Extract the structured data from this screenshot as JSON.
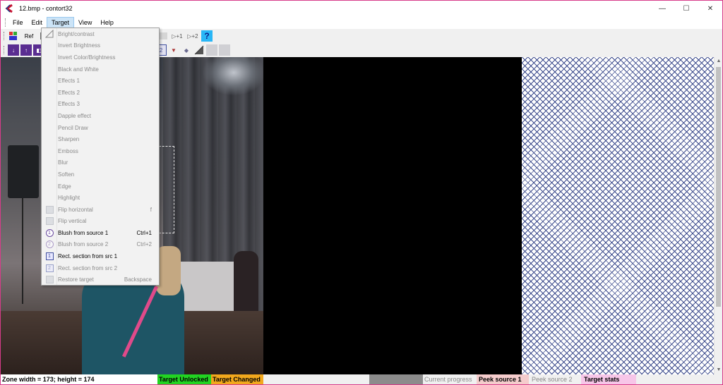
{
  "window": {
    "title": "12.bmp - contort32",
    "controls": {
      "minimize": "—",
      "maximize": "☐",
      "close": "✕"
    }
  },
  "menubar": {
    "items": [
      "File",
      "Edit",
      "Target",
      "View",
      "Help"
    ],
    "active": "Target"
  },
  "toolbar1": {
    "buttons": [
      {
        "icon": "rgb-icon",
        "label": ""
      },
      {
        "icon": "ref-icon",
        "label": "Ref"
      },
      {
        "icon": "frame-icon",
        "label": ""
      },
      {
        "icon": "blank-icon",
        "label": ""
      },
      {
        "icon": "step1-icon",
        "label": "▷+1"
      },
      {
        "icon": "step2-icon",
        "label": "▷+2"
      },
      {
        "icon": "help-icon",
        "label": "?"
      }
    ]
  },
  "toolbar2": {
    "buttons": [
      {
        "icon": "down-arrow-icon",
        "label": ""
      },
      {
        "icon": "up-arrow-icon",
        "label": ""
      },
      {
        "icon": "select-icon",
        "label": ""
      },
      {
        "icon": "src2-icon",
        "label": "2"
      },
      {
        "icon": "paint-icon",
        "label": ""
      },
      {
        "icon": "eraser-icon",
        "label": ""
      },
      {
        "icon": "brightness-icon",
        "label": ""
      },
      {
        "icon": "flip-h-icon",
        "label": ""
      },
      {
        "icon": "flip-v-icon",
        "label": ""
      }
    ]
  },
  "dropdown": {
    "items": [
      {
        "label": "Bright/contrast",
        "shortcut": "",
        "enabled": false,
        "icon": "brightness-icon"
      },
      {
        "label": "Invert Brightness",
        "shortcut": "",
        "enabled": false,
        "icon": ""
      },
      {
        "label": "Invert Color/Brightness",
        "shortcut": "",
        "enabled": false,
        "icon": ""
      },
      {
        "label": "Black and White",
        "shortcut": "",
        "enabled": false,
        "icon": ""
      },
      {
        "label": "Effects 1",
        "shortcut": "",
        "enabled": false,
        "icon": ""
      },
      {
        "label": "Effects 2",
        "shortcut": "",
        "enabled": false,
        "icon": ""
      },
      {
        "label": "Effects 3",
        "shortcut": "",
        "enabled": false,
        "icon": ""
      },
      {
        "label": "Dapple effect",
        "shortcut": "",
        "enabled": false,
        "icon": ""
      },
      {
        "label": "Pencil Draw",
        "shortcut": "",
        "enabled": false,
        "icon": ""
      },
      {
        "label": "Sharpen",
        "shortcut": "",
        "enabled": false,
        "icon": ""
      },
      {
        "label": "Emboss",
        "shortcut": "",
        "enabled": false,
        "icon": ""
      },
      {
        "label": "Blur",
        "shortcut": "",
        "enabled": false,
        "icon": ""
      },
      {
        "label": "Soften",
        "shortcut": "",
        "enabled": false,
        "icon": ""
      },
      {
        "label": "Edge",
        "shortcut": "",
        "enabled": false,
        "icon": ""
      },
      {
        "label": "Highlight",
        "shortcut": "",
        "enabled": false,
        "icon": ""
      },
      {
        "label": "Flip horizontal",
        "shortcut": "f",
        "enabled": false,
        "icon": "flip-horizontal-icon"
      },
      {
        "label": "Flip vertical",
        "shortcut": "",
        "enabled": false,
        "icon": "flip-vertical-icon"
      },
      {
        "label": "Blush from source 1",
        "shortcut": "Ctrl+1",
        "enabled": true,
        "icon": "source1-circle-icon"
      },
      {
        "label": "Blush from source 2",
        "shortcut": "Ctrl+2",
        "enabled": false,
        "icon": "source2-circle-icon"
      },
      {
        "label": "Rect. section from src 1",
        "shortcut": "",
        "enabled": true,
        "icon": "source1-rect-icon"
      },
      {
        "label": "Rect. section from src 2",
        "shortcut": "",
        "enabled": false,
        "icon": "source2-rect-icon"
      },
      {
        "label": "Restore target",
        "shortcut": "Backspace",
        "enabled": false,
        "icon": "restore-icon"
      }
    ]
  },
  "statusbar": {
    "zone": "Zone width = 173; height = 174",
    "unlocked": "Target Unlocked",
    "changed": "Target Changed",
    "current_progress": "Current progress",
    "peek1": "Peek source 1",
    "peek2": "Peek source 2",
    "target_stats": "Target stats"
  },
  "colors": {
    "unlocked": "#22d422",
    "changed": "#f2a81d",
    "peek1": "#f5cccc",
    "target_stats": "#f7c6e8",
    "hatch": "#3b4a8c",
    "window_border": "#d83b8a"
  }
}
